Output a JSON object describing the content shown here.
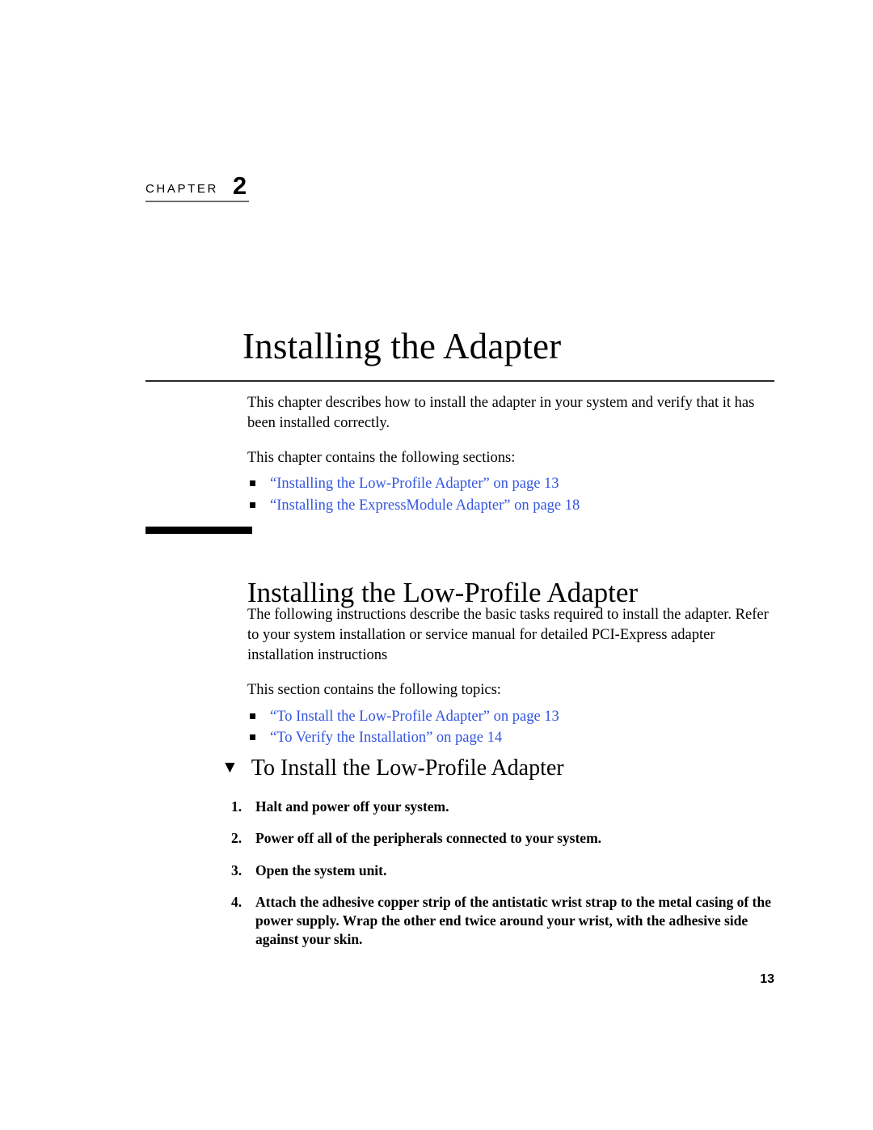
{
  "page": {
    "folio": "13",
    "chapter_label": "CHAPTER",
    "chapter_number": "2",
    "chapter_title": "Installing the Adapter"
  },
  "colors": {
    "link": "#3355e0",
    "rule": "#2a2a2a",
    "bar": "#000000"
  },
  "intro": {
    "paragraph_1": "This chapter describes how to install the adapter in your system and verify that it has been installed correctly.",
    "paragraph_2": "This chapter contains the following sections:",
    "links": [
      {
        "text": "“Installing the Low-Profile Adapter” on page 13"
      },
      {
        "text": "“Installing the ExpressModule Adapter” on page 18"
      }
    ]
  },
  "section": {
    "heading": "Installing the Low-Profile Adapter",
    "paragraph_1": "The following instructions describe the basic tasks required to install the adapter. Refer to your system installation or service manual for detailed PCI-Express adapter installation instructions",
    "paragraph_2": "This section contains the following topics:",
    "links": [
      {
        "text": "“To Install the Low-Profile Adapter” on page 13"
      },
      {
        "text": "“To Verify the Installation” on page 14"
      }
    ]
  },
  "procedure": {
    "marker": "▼",
    "heading": "To Install the Low-Profile Adapter",
    "steps": [
      {
        "num": "1.",
        "text": "Halt and power off your system."
      },
      {
        "num": "2.",
        "text": "Power off all of the peripherals connected to your system."
      },
      {
        "num": "3.",
        "text": "Open the system unit."
      },
      {
        "num": "4.",
        "text": "Attach the adhesive copper strip of the antistatic wrist strap to the metal casing of the power supply. Wrap the other end twice around your wrist, with the adhesive side against your skin."
      }
    ]
  }
}
